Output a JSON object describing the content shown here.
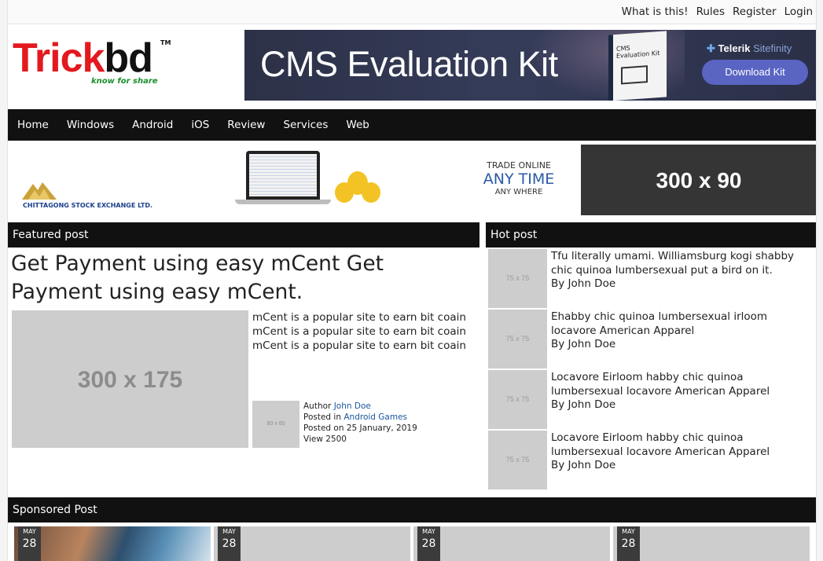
{
  "toplinks": [
    "What is this!",
    "Rules",
    "Register",
    "Login"
  ],
  "logo": {
    "name_red": "Trick",
    "name_black": "bd",
    "tm": "TM",
    "tagline": "know for share"
  },
  "cms_ad": {
    "title": "CMS Evaluation Kit",
    "box_text": "CMS Evaluation Kit",
    "brand": "Telerik",
    "brand_product": "Sitefinity",
    "button": "Download Kit"
  },
  "nav": [
    "Home",
    "Windows",
    "Android",
    "iOS",
    "Review",
    "Services",
    "Web"
  ],
  "cse_ad": {
    "company": "CHITTAGONG STOCK EXCHANGE LTD.",
    "trade_1": "TRADE ONLINE",
    "trade_2": "ANY TIME",
    "trade_3": "ANY WHERE"
  },
  "ad_300x90": "300 x 90",
  "featured": {
    "header": "Featured post",
    "title": "Get Payment using easy mCent Get Payment using easy mCent.",
    "image_label": "300 x 175",
    "excerpt_lines": [
      "mCent is a popular site to earn bit coain",
      "mCent is a popular site to earn bit coain",
      "mCent is a popular site to earn bit coain"
    ],
    "meta_image_label": "60 x 60",
    "author_label": "Author",
    "author": "John Doe",
    "posted_in_label": "Posted in",
    "category": "Android Games",
    "posted_on_label": "Posted on",
    "date": "25 January, 2019",
    "views": "View 2500"
  },
  "hot": {
    "header": "Hot post",
    "items": [
      {
        "thumb": "75 x 75",
        "title": "Tfu literally umami. Williamsburg kogi shabby chic quinoa lumbersexual put a bird on it.",
        "by": "By John Doe"
      },
      {
        "thumb": "75 x 75",
        "title": "Ehabby chic quinoa lumbersexual irloom locavore American Apparel",
        "by": "By John Doe"
      },
      {
        "thumb": "75 x 75",
        "title": "Locavore Eirloom habby chic quinoa lumbersexual locavore American Apparel",
        "by": "By John Doe"
      },
      {
        "thumb": "75 x 75",
        "title": "Locavore Eirloom habby chic quinoa lumbersexual locavore American Apparel",
        "by": "By John Doe"
      }
    ]
  },
  "sponsored": {
    "header": "Sponsored Post",
    "cards": [
      {
        "month": "MAY",
        "day": "28"
      },
      {
        "month": "MAY",
        "day": "28"
      },
      {
        "month": "MAY",
        "day": "28"
      },
      {
        "month": "MAY",
        "day": "28"
      }
    ]
  }
}
